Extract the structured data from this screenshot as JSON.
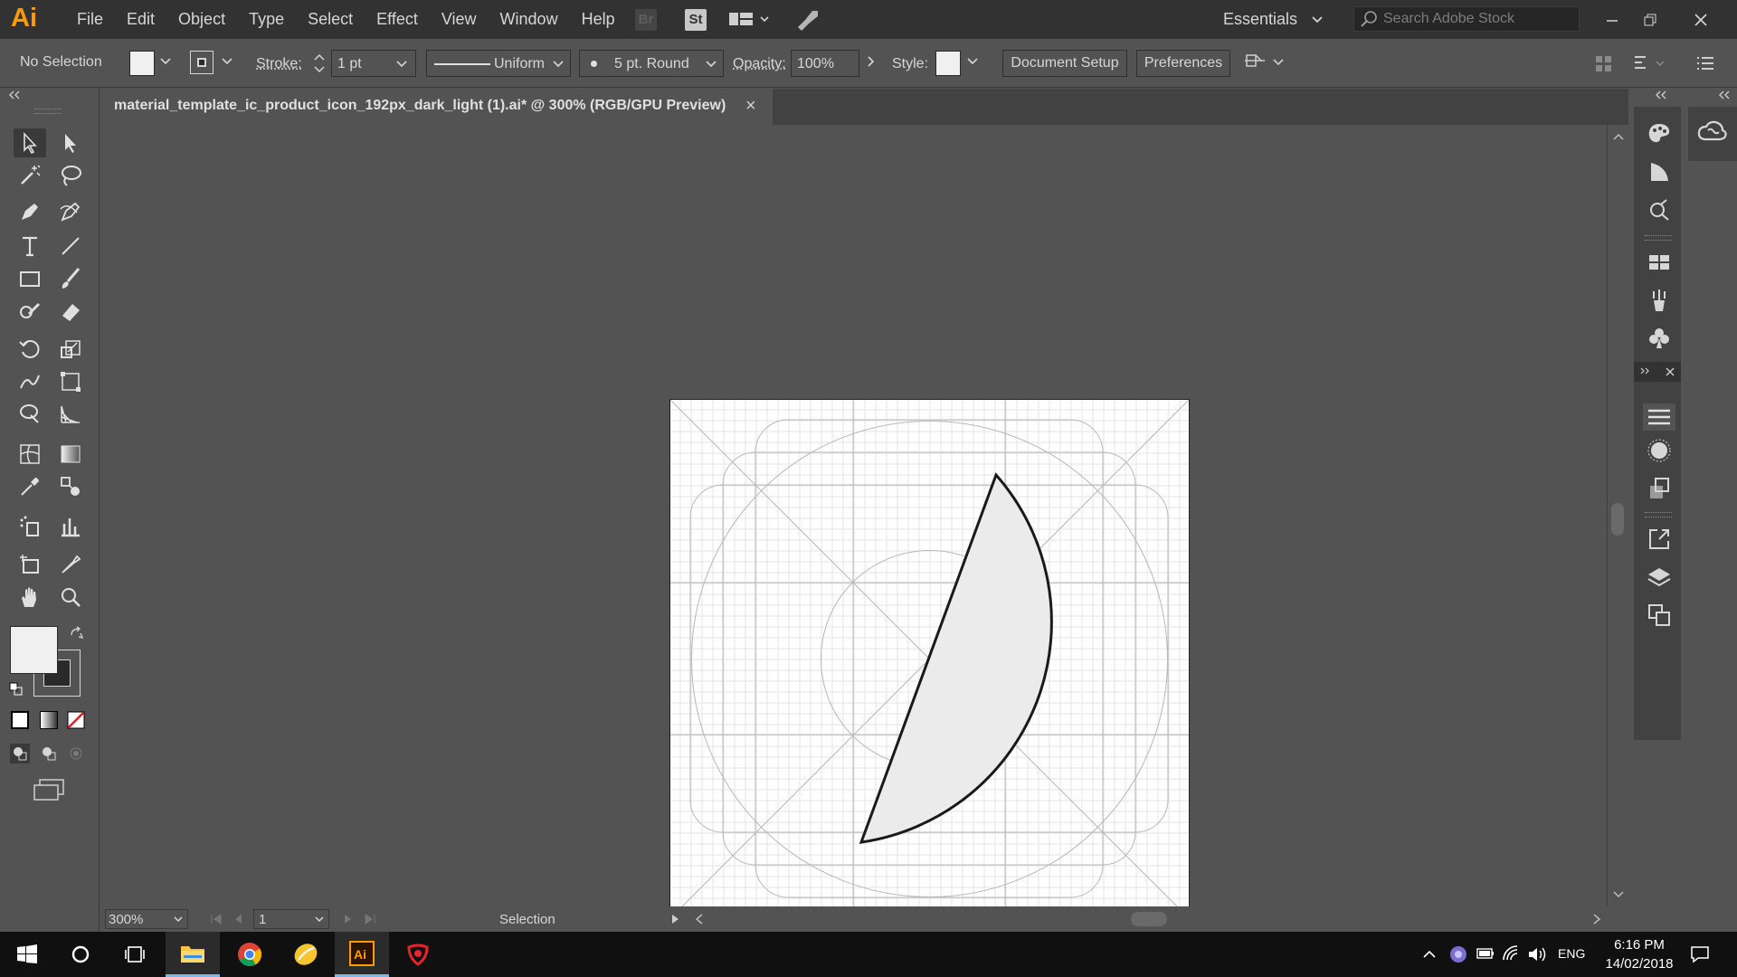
{
  "app": {
    "logo": "Ai"
  },
  "menu": {
    "items": [
      "File",
      "Edit",
      "Object",
      "Type",
      "Select",
      "Effect",
      "View",
      "Window",
      "Help"
    ]
  },
  "header": {
    "bridge_badge": "Br",
    "stock_badge": "St",
    "workspace": "Essentials",
    "search_placeholder": "Search Adobe Stock"
  },
  "control": {
    "selection_status": "No Selection",
    "stroke_label": "Stroke:",
    "stroke_weight": "1 pt",
    "stroke_profile": "Uniform",
    "brush": "5 pt. Round",
    "opacity_label": "Opacity:",
    "opacity_value": "100%",
    "style_label": "Style:",
    "document_setup": "Document Setup",
    "preferences": "Preferences"
  },
  "document": {
    "tab_title": "material_template_ic_product_icon_192px_dark_light (1).ai* @ 300% (RGB/GPU Preview)",
    "close_glyph": "×"
  },
  "status": {
    "zoom": "300%",
    "artboard": "1",
    "tool": "Selection"
  },
  "taskbar": {
    "language": "ENG",
    "time": "6:16 PM",
    "date": "14/02/2018"
  },
  "colors": {
    "menubar": "#323232",
    "workspace_bg": "#535353",
    "ai_orange": "#ff9a00",
    "taskbar": "#101010",
    "shape_fill": "#ebebeb",
    "shape_stroke": "#1a1a1a"
  }
}
